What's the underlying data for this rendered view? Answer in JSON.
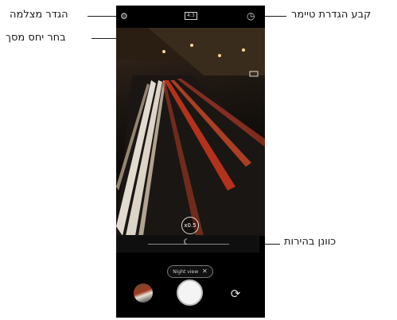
{
  "callouts": {
    "timer": "קבע הגדרת טיימר",
    "settings": "הגדר מצלמה",
    "ratio": "בחר יחס מסך",
    "brightness": "כוונן בהירות"
  },
  "camera": {
    "ratio_label": "4:3",
    "zoom_label": "x0.5",
    "mode_chip": "Night view"
  },
  "icons": {
    "settings": "gear-icon",
    "timer": "timer-icon",
    "ratio": "aspect-ratio-icon",
    "switch": "switch-camera-icon",
    "close": "close-icon",
    "moon": "moon-icon"
  }
}
